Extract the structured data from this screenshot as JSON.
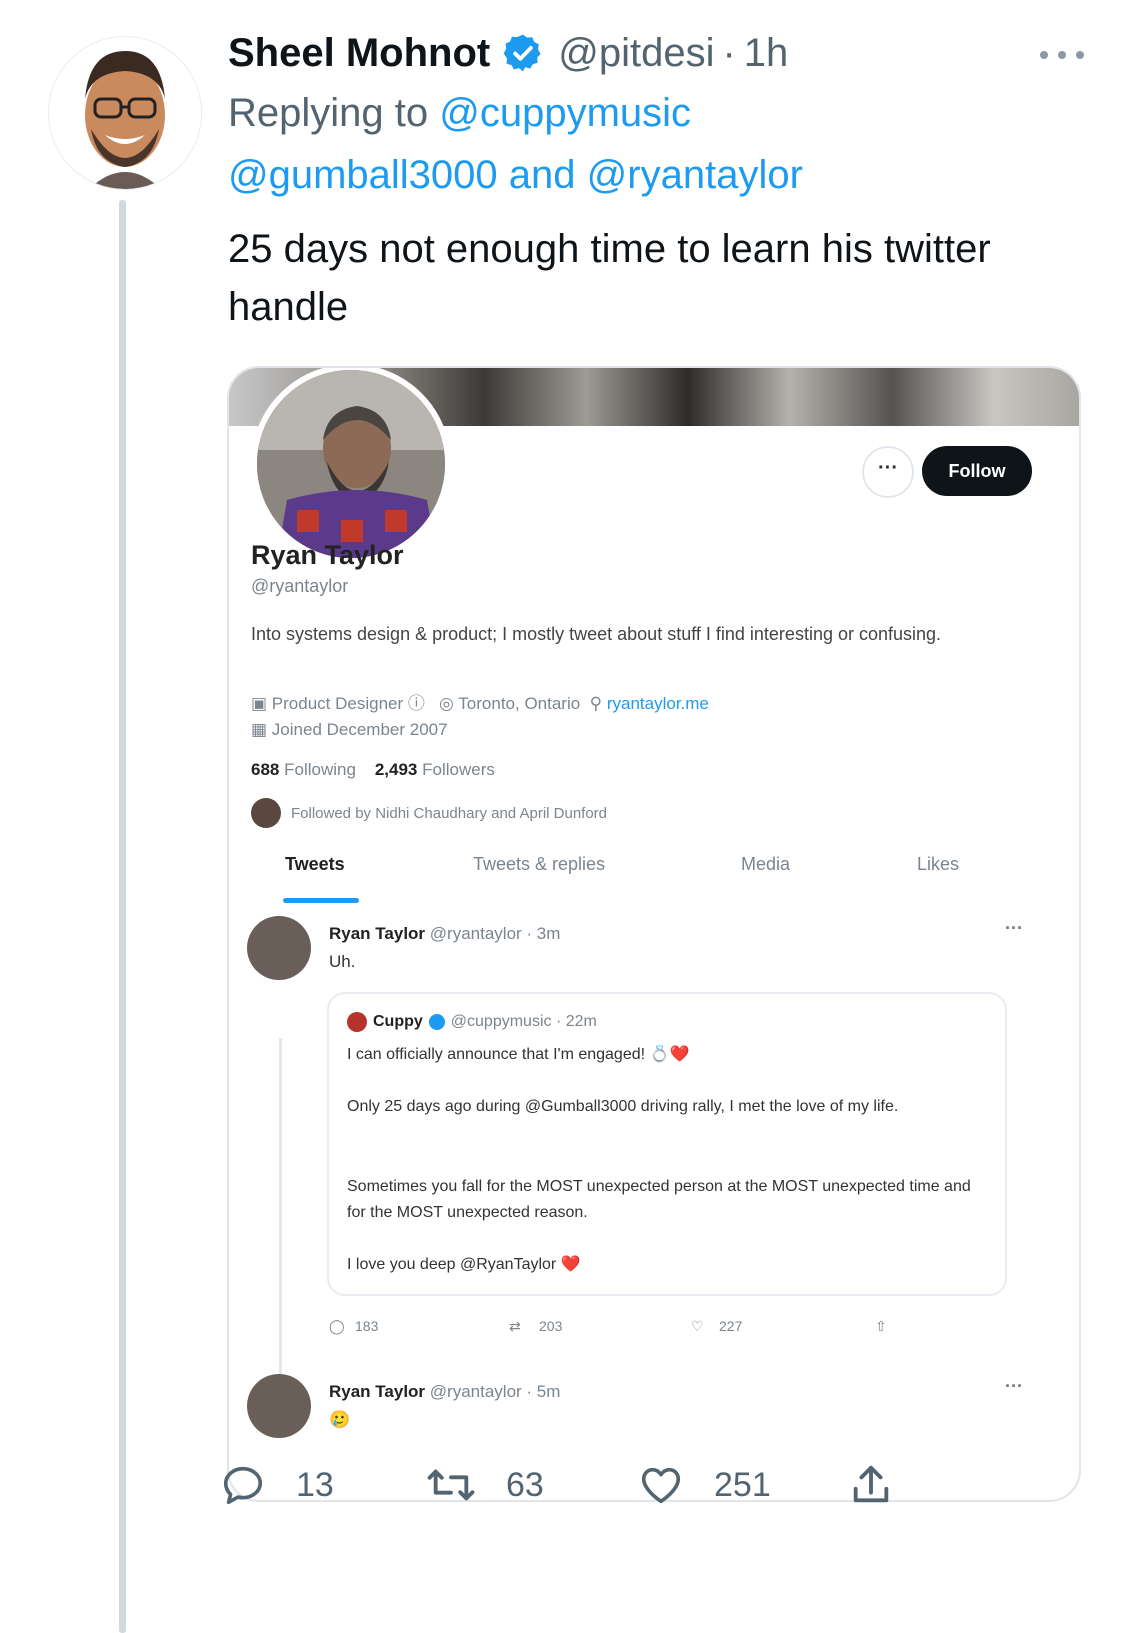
{
  "tweet": {
    "display_name": "Sheel Mohnot",
    "handle": "@pitdesi",
    "separator": "·",
    "time": "1h",
    "replying_prefix": "Replying to",
    "reply_mention_1": "@cuppymusic",
    "reply_mention_2": "@gumball3000",
    "reply_and": "and",
    "reply_mention_3": "@ryantaylor",
    "text": "25 days not enough time to learn his twitter handle",
    "reply_count": "13",
    "retweet_count": "63",
    "like_count": "251",
    "icons": {
      "verified": "verified-badge-icon",
      "more": "more-icon",
      "reply": "reply-icon",
      "retweet": "retweet-icon",
      "like": "heart-icon",
      "share": "share-icon"
    },
    "colors": {
      "accent": "#1d9bf0",
      "muted": "#536471",
      "text": "#0f1419"
    }
  },
  "embedded": {
    "profile": {
      "follow_label": "Follow",
      "more_label": "···",
      "name": "Ryan Taylor",
      "handle": "@ryantaylor",
      "bio": "Into systems design & product; I mostly tweet about stuff I find interesting or confusing.",
      "occupation": "Product Designer",
      "location": "Toronto, Ontario",
      "website": "ryantaylor.me",
      "joined": "Joined December 2007",
      "following_count": "688",
      "following_label": "Following",
      "followers_count": "2,493",
      "followers_label": "Followers",
      "followed_by": "Followed by Nidhi Chaudhary and April Dunford"
    },
    "tabs": [
      "Tweets",
      "Tweets & replies",
      "Media",
      "Likes"
    ],
    "tweet1": {
      "name": "Ryan Taylor",
      "meta": "@ryantaylor · 3m",
      "text": "Uh."
    },
    "quote": {
      "name": "Cuppy",
      "meta": "@cuppymusic · 22m",
      "line1": "I can officially announce that I'm engaged! 💍❤️",
      "line2": "Only 25 days ago during @Gumball3000 driving rally, I met the love of my life.",
      "line3": "Sometimes you fall for the MOST unexpected person at the MOST unexpected time and for the MOST unexpected reason.",
      "line4": "I love you deep @RyanTaylor ❤️"
    },
    "tweet1_actions": {
      "replies": "183",
      "retweets": "203",
      "likes": "227"
    },
    "tweet2": {
      "name": "Ryan Taylor",
      "meta": "@ryantaylor · 5m",
      "text": "🥲"
    }
  }
}
